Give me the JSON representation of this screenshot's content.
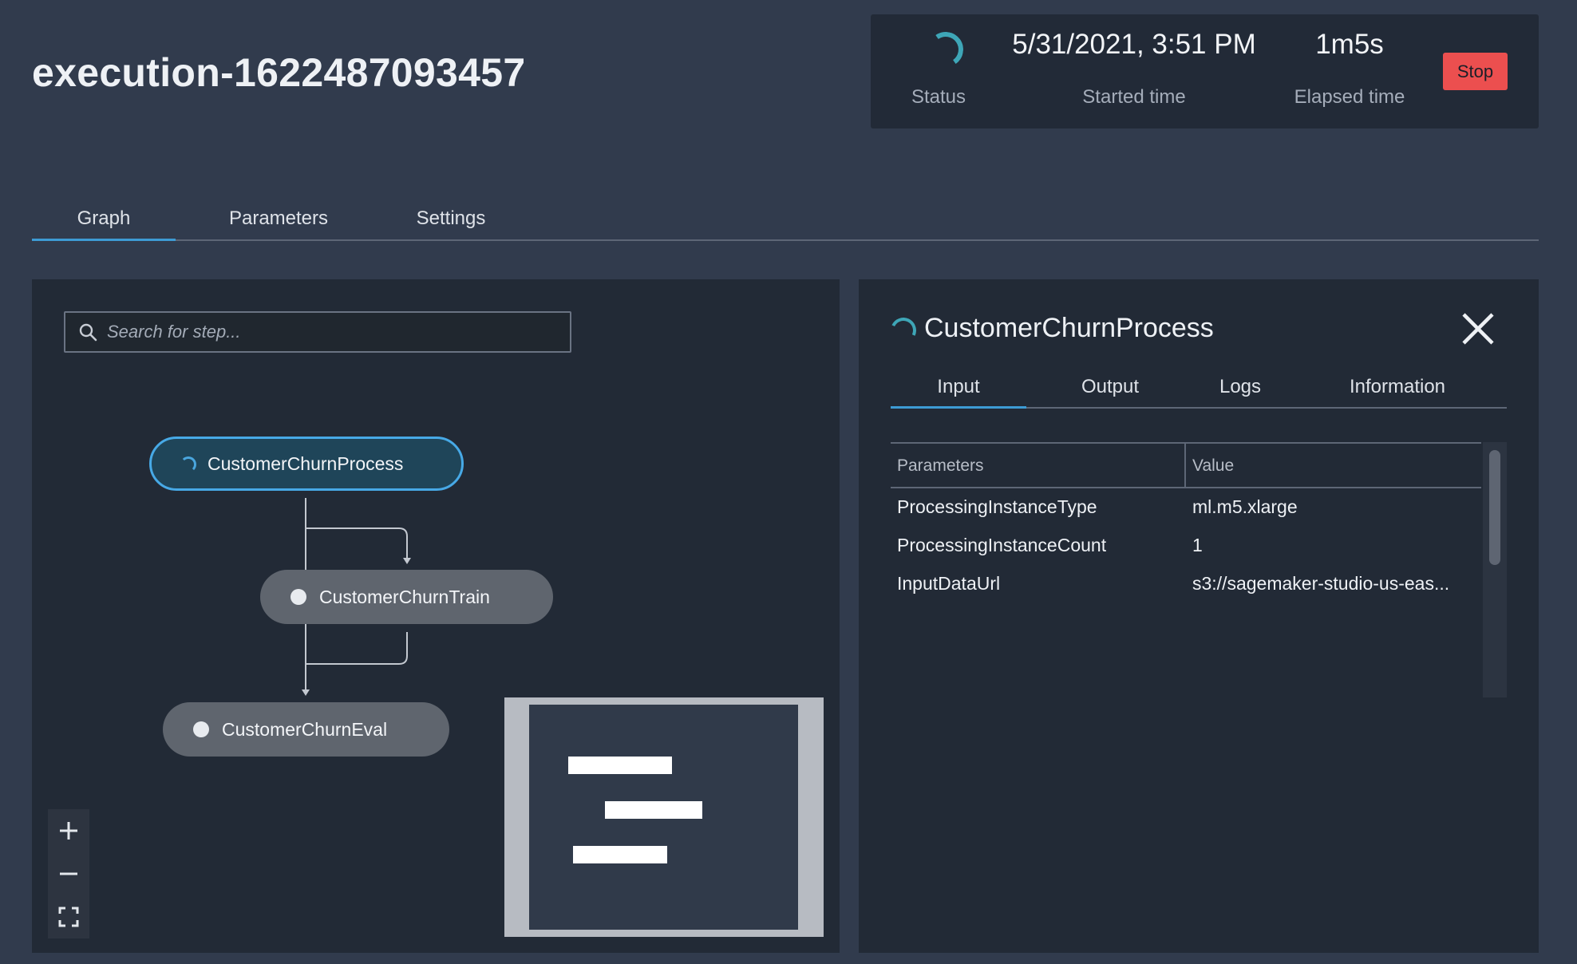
{
  "execution": {
    "title": "execution-1622487093457"
  },
  "status_panel": {
    "status_label": "Status",
    "started_value": "5/31/2021, 3:51 PM",
    "started_label": "Started time",
    "elapsed_value": "1m5s",
    "elapsed_label": "Elapsed time",
    "stop_label": "Stop",
    "spinner_icon": "loading-spinner-icon",
    "accent_color": "#3ea6b7",
    "stop_color": "#ec4f4f"
  },
  "tabs": [
    {
      "label": "Graph",
      "active": true
    },
    {
      "label": "Parameters",
      "active": false
    },
    {
      "label": "Settings",
      "active": false
    }
  ],
  "graph": {
    "search_placeholder": "Search for step...",
    "search_icon": "search-icon",
    "nodes": [
      {
        "label": "CustomerChurnProcess",
        "state": "running"
      },
      {
        "label": "CustomerChurnTrain",
        "state": "pending"
      },
      {
        "label": "CustomerChurnEval",
        "state": "pending"
      }
    ],
    "zoom_in_icon": "plus-icon",
    "zoom_out_icon": "minus-icon",
    "fit_icon": "fit-screen-icon"
  },
  "detail": {
    "title": "CustomerChurnProcess",
    "close_icon": "close-icon",
    "tabs": [
      {
        "label": "Input",
        "active": true
      },
      {
        "label": "Output",
        "active": false
      },
      {
        "label": "Logs",
        "active": false
      },
      {
        "label": "Information",
        "active": false
      }
    ],
    "table": {
      "headers": [
        "Parameters",
        "Value"
      ],
      "rows": [
        {
          "param": "ProcessingInstanceType",
          "value": "ml.m5.xlarge"
        },
        {
          "param": "ProcessingInstanceCount",
          "value": "1"
        },
        {
          "param": "InputDataUrl",
          "value": "s3://sagemaker-studio-us-eas..."
        }
      ]
    }
  }
}
